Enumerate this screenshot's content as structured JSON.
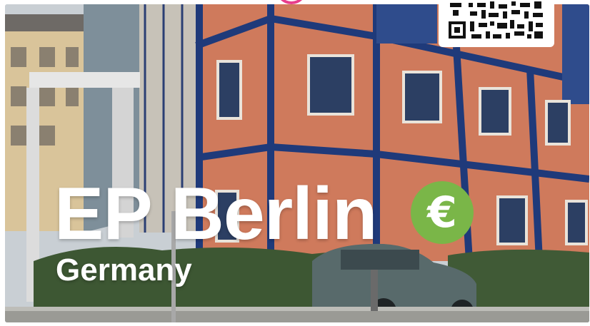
{
  "card": {
    "title": "EP Berlin",
    "subtitle": "Germany",
    "currency_symbol": "€",
    "currency_badge_color": "#7ab648",
    "qr_icon": "qr-code-icon",
    "accent_color": "#e83e8c"
  }
}
